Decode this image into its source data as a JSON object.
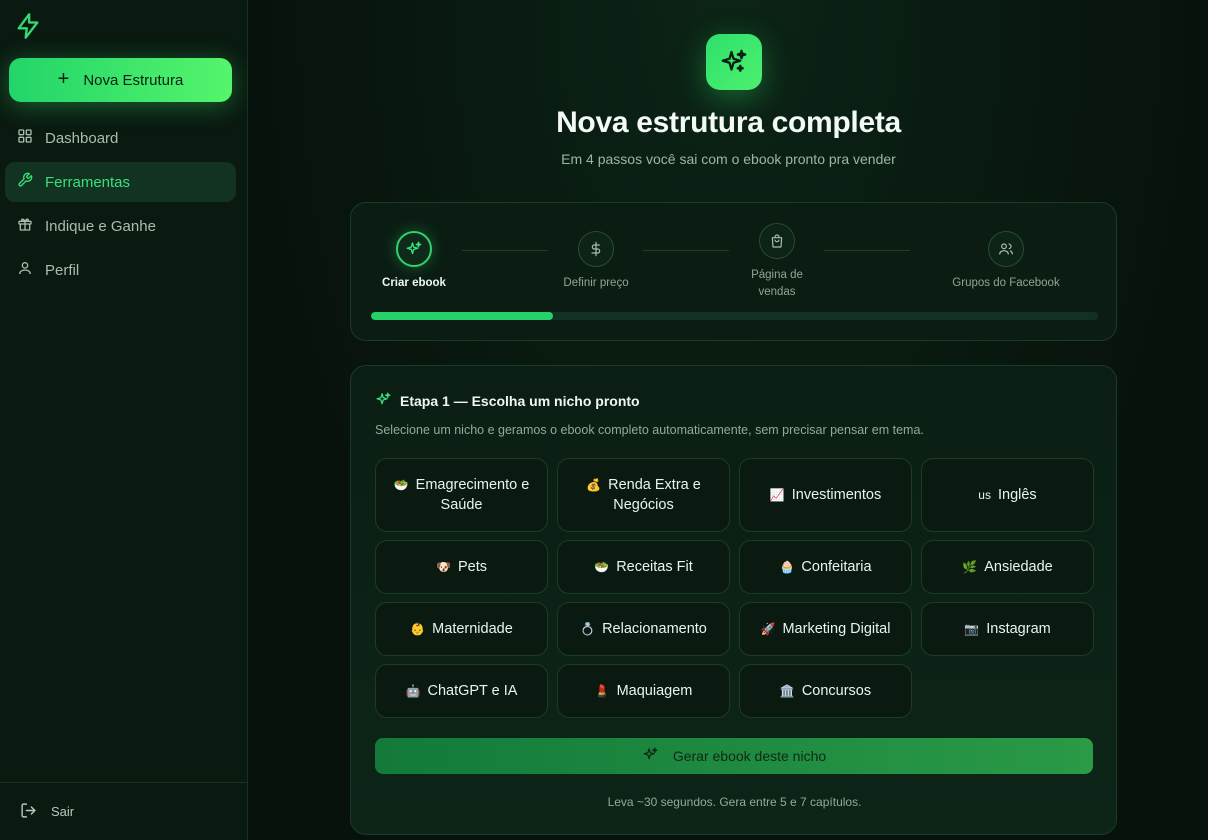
{
  "sidebar": {
    "logo_icon": "lightning-bolt-icon",
    "new_button": "Nova Estrutura",
    "items": [
      {
        "label": "Dashboard",
        "icon": "grid-icon",
        "active": false
      },
      {
        "label": "Ferramentas",
        "icon": "wrench-icon",
        "active": true
      },
      {
        "label": "Indique e Ganhe",
        "icon": "gift-icon",
        "active": false
      },
      {
        "label": "Perfil",
        "icon": "user-icon",
        "active": false
      }
    ],
    "logout": "Sair"
  },
  "hero": {
    "icon": "sparkles-icon",
    "title": "Nova estrutura completa",
    "subtitle": "Em 4 passos você sai com o ebook pronto pra vender"
  },
  "steps": [
    {
      "label": "Criar ebook",
      "icon": "sparkles-icon",
      "active": true
    },
    {
      "label": "Definir preço",
      "icon": "dollar-icon",
      "active": false
    },
    {
      "label": "Página de vendas",
      "icon": "shopping-bag-icon",
      "active": false
    },
    {
      "label": "Grupos do Facebook",
      "icon": "users-icon",
      "active": false
    }
  ],
  "progress_fraction": 0.25,
  "step_panel": {
    "title": "Etapa 1 — Escolha um nicho pronto",
    "description": "Selecione um nicho e geramos o ebook completo automaticamente, sem precisar pensar em tema.",
    "niches": [
      {
        "emoji": "🥗",
        "label": "Emagrecimento e Saúde"
      },
      {
        "emoji": "💰",
        "label": "Renda Extra e Negócios"
      },
      {
        "emoji": "📈",
        "label": "Investimentos"
      },
      {
        "emoji": "us",
        "label": "Inglês"
      },
      {
        "emoji": "🐶",
        "label": "Pets"
      },
      {
        "emoji": "🥗",
        "label": "Receitas Fit"
      },
      {
        "emoji": "🧁",
        "label": "Confeitaria"
      },
      {
        "emoji": "🌿",
        "label": "Ansiedade"
      },
      {
        "emoji": "👶",
        "label": "Maternidade"
      },
      {
        "emoji": "💍",
        "label": "Relacionamento"
      },
      {
        "emoji": "🚀",
        "label": "Marketing Digital"
      },
      {
        "emoji": "📷",
        "label": "Instagram"
      },
      {
        "emoji": "🤖",
        "label": "ChatGPT e IA"
      },
      {
        "emoji": "💄",
        "label": "Maquiagem"
      },
      {
        "emoji": "🏛️",
        "label": "Concursos"
      }
    ],
    "generate_button": "Gerar ebook deste nicho",
    "note": "Leva ~30 segundos. Gera entre 5 e 7 capítulos."
  }
}
